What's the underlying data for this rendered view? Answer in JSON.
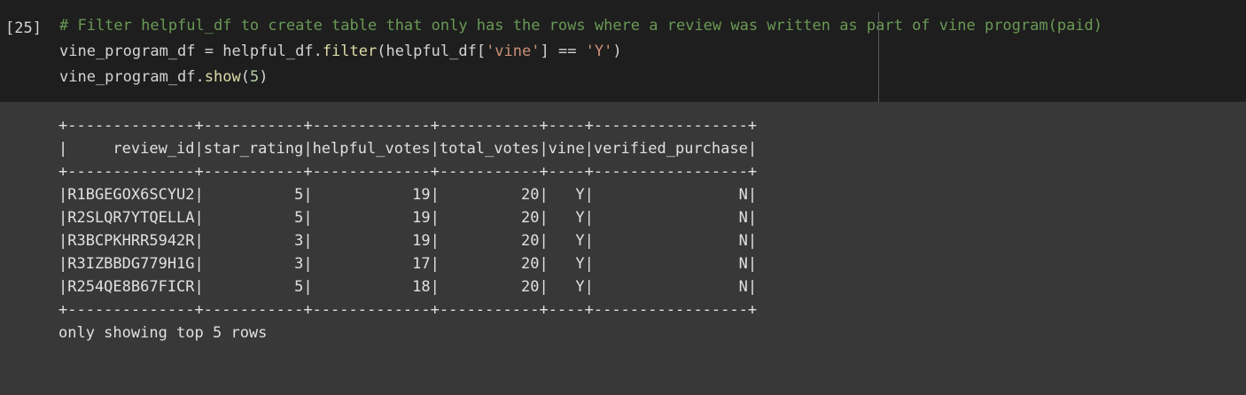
{
  "cell": {
    "execution_count": "[25]",
    "code_lines": [
      [
        {
          "t": "# Filter helpful_df to create table that only has the rows where a review was written as part of vine program(paid)",
          "c": "comment"
        }
      ],
      [
        {
          "t": "vine_program_df = helpful_df.",
          "c": ""
        },
        {
          "t": "filter",
          "c": "fn"
        },
        {
          "t": "(helpful_df[",
          "c": ""
        },
        {
          "t": "'vine'",
          "c": "str"
        },
        {
          "t": "] == ",
          "c": ""
        },
        {
          "t": "'Y'",
          "c": "str"
        },
        {
          "t": ")",
          "c": ""
        }
      ],
      [
        {
          "t": "vine_program_df.",
          "c": ""
        },
        {
          "t": "show",
          "c": "fn"
        },
        {
          "t": "(",
          "c": ""
        },
        {
          "t": "5",
          "c": "num"
        },
        {
          "t": ")",
          "c": ""
        }
      ]
    ]
  },
  "output": {
    "lines": [
      "+--------------+-----------+-------------+-----------+----+-----------------+",
      "|     review_id|star_rating|helpful_votes|total_votes|vine|verified_purchase|",
      "+--------------+-----------+-------------+-----------+----+-----------------+",
      "|R1BGEGOX6SCYU2|          5|           19|         20|   Y|                N|",
      "|R2SLQR7YTQELLA|          5|           19|         20|   Y|                N|",
      "|R3BCPKHRR5942R|          3|           19|         20|   Y|                N|",
      "|R3IZBBDG779H1G|          3|           17|         20|   Y|                N|",
      "|R254QE8B67FICR|          5|           18|         20|   Y|                N|",
      "+--------------+-----------+-------------+-----------+----+-----------------+",
      "only showing top 5 rows"
    ]
  }
}
